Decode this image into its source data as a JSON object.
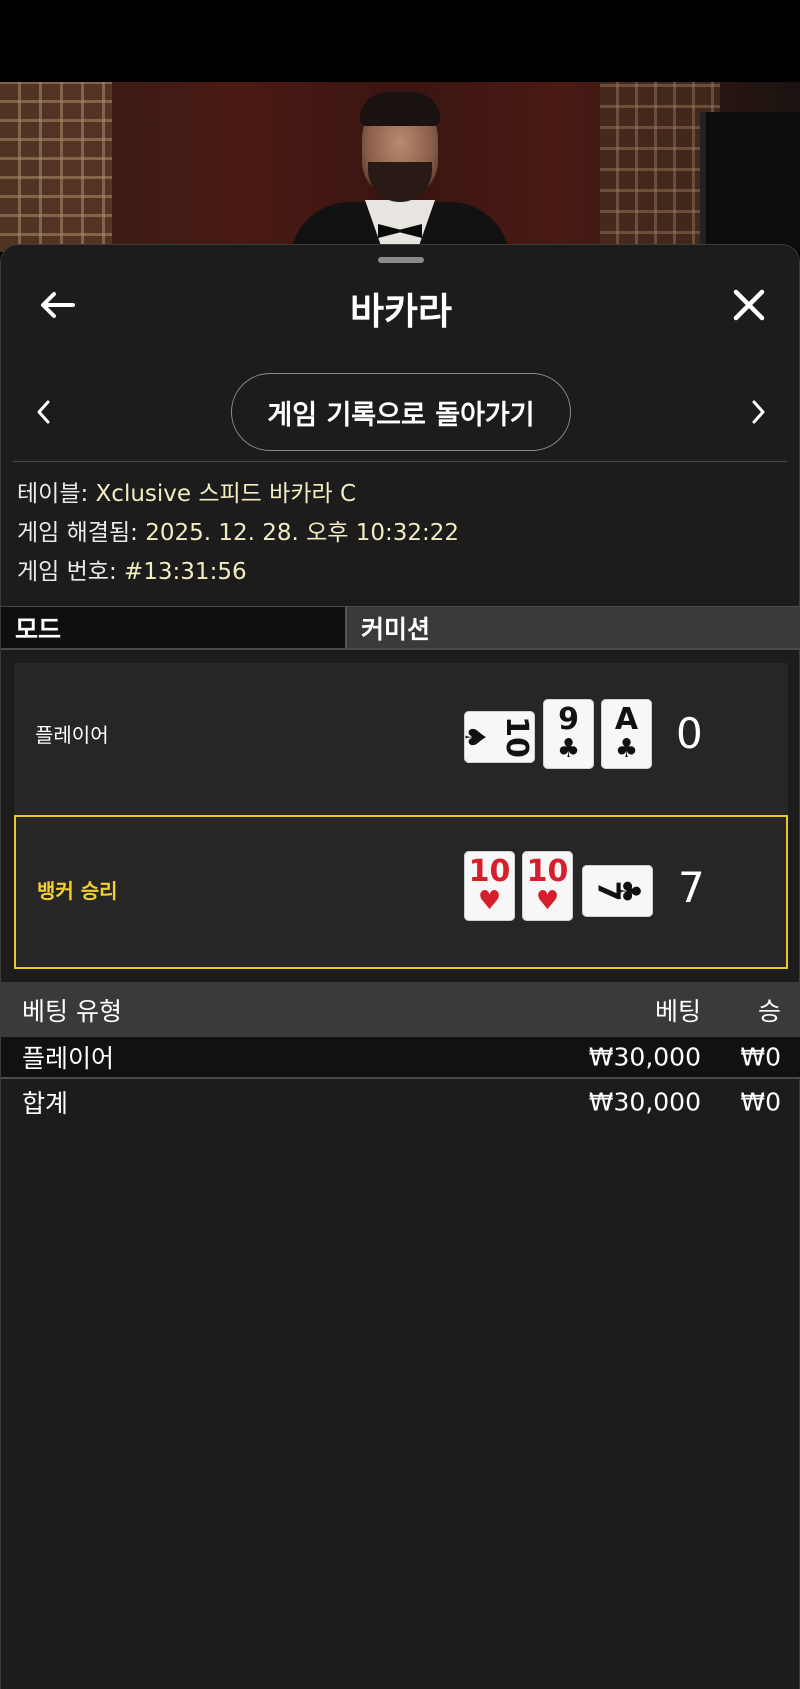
{
  "window": {
    "title": "바카라"
  },
  "nav": {
    "back_to_history": "게임 기록으로 돌아가기"
  },
  "info": {
    "table_key": "테이블:",
    "table_value": "Xclusive 스피드 바카라 C",
    "resolved_key": "게임 해결됨:",
    "resolved_value": "2025. 12. 28. 오후 10:32:22",
    "game_no_key": "게임 번호:",
    "game_no_value": "#13:31:56"
  },
  "tabs": {
    "mode": "모드",
    "commission": "커미션"
  },
  "hands": {
    "player": {
      "label": "플레이어",
      "score": "0",
      "cards": [
        {
          "rank": "10",
          "suit": "♠",
          "color": "#111111",
          "orientation": "sideways"
        },
        {
          "rank": "9",
          "suit": "♣",
          "color": "#111111",
          "orientation": "upright"
        },
        {
          "rank": "A",
          "suit": "♣",
          "color": "#111111",
          "orientation": "upright"
        }
      ]
    },
    "banker": {
      "label": "뱅커 승리",
      "score": "7",
      "highlight_color": "#e9c72e",
      "cards": [
        {
          "rank": "10",
          "suit": "♥",
          "color": "#d61f2c",
          "orientation": "upright"
        },
        {
          "rank": "10",
          "suit": "♥",
          "color": "#d61f2c",
          "orientation": "upright"
        },
        {
          "rank": "7",
          "suit": "♣",
          "color": "#111111",
          "orientation": "sideways"
        }
      ]
    }
  },
  "bets": {
    "headers": {
      "type": "베팅 유형",
      "bet": "베팅",
      "win": "승"
    },
    "rows": [
      {
        "type": "플레이어",
        "bet": "₩30,000",
        "win": "₩0"
      }
    ],
    "total": {
      "type": "합계",
      "bet": "₩30,000",
      "win": "₩0"
    }
  },
  "icons": {
    "back": "arrow-left-icon",
    "close": "close-icon",
    "prev": "chevron-left-icon",
    "next": "chevron-right-icon"
  }
}
